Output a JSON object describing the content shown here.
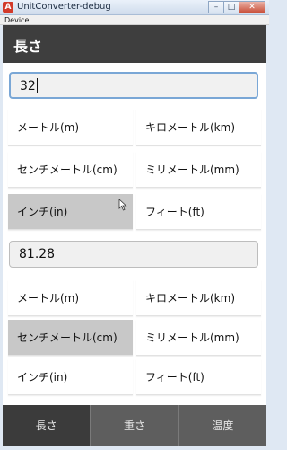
{
  "window": {
    "title": "UnitConverter-debug",
    "icon_label": "A",
    "menu": [
      "Device"
    ],
    "buttons": {
      "minimize": "–",
      "maximize": "□",
      "close": "✕"
    }
  },
  "header": {
    "title": "長さ"
  },
  "input": {
    "value": "32"
  },
  "from_units": [
    {
      "label": "メートル(m)",
      "selected": false
    },
    {
      "label": "キロメートル(km)",
      "selected": false
    },
    {
      "label": "センチメートル(cm)",
      "selected": false
    },
    {
      "label": "ミリメートル(mm)",
      "selected": false
    },
    {
      "label": "インチ(in)",
      "selected": true
    },
    {
      "label": "フィート(ft)",
      "selected": false
    }
  ],
  "result": {
    "value": "81.28"
  },
  "to_units": [
    {
      "label": "メートル(m)",
      "selected": false
    },
    {
      "label": "キロメートル(km)",
      "selected": false
    },
    {
      "label": "センチメートル(cm)",
      "selected": true
    },
    {
      "label": "ミリメートル(mm)",
      "selected": false
    },
    {
      "label": "インチ(in)",
      "selected": false
    },
    {
      "label": "フィート(ft)",
      "selected": false
    }
  ],
  "tabs": [
    {
      "label": "長さ",
      "active": true
    },
    {
      "label": "重さ",
      "active": false
    },
    {
      "label": "温度",
      "active": false
    }
  ],
  "colors": {
    "header_bg": "#3e3e3e",
    "tab_bg": "#5e5e5e",
    "tab_active_bg": "#3b3b3b",
    "selected_bg": "#c8c8c8",
    "focus_border": "#7aa7d6"
  },
  "icons": {
    "app": "app-icon",
    "cursor": "mouse-pointer-icon"
  }
}
